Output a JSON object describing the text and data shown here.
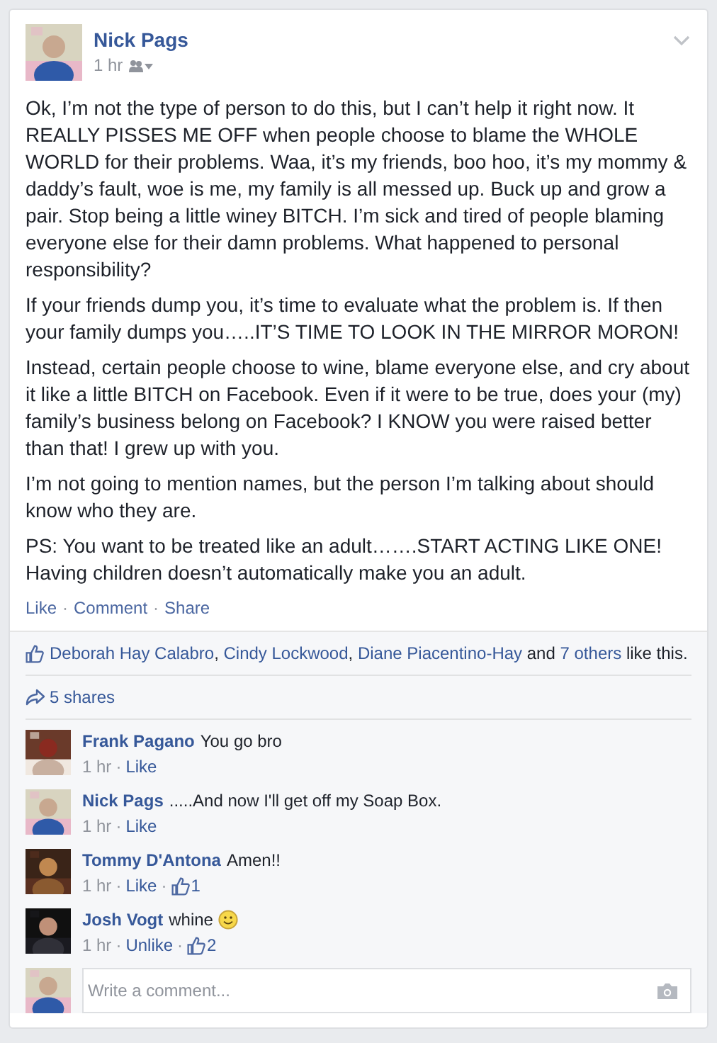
{
  "post": {
    "author": "Nick Pags",
    "time": "1 hr",
    "paragraphs": [
      "Ok, I’m not the type of person to do this, but I can’t help it right now. It REALLY PISSES ME OFF when people choose to blame the WHOLE WORLD for their problems. Waa, it’s my friends, boo hoo, it’s my mommy & daddy’s fault, woe is me, my family is all messed up. Buck up and grow a pair. Stop being a little winey BITCH. I’m sick and tired of people blaming everyone else for their damn problems. What happened to personal responsibility?",
      "If your friends dump you, it’s time to evaluate what the problem is. If then your family dumps you…..IT’S TIME TO LOOK IN THE MIRROR MORON!",
      "Instead, certain people choose to wine, blame everyone else, and cry about it like a little BITCH on Facebook. Even if it were to be true, does your (my) family’s business belong on Facebook? I KNOW you were raised better than that! I grew up with you.",
      "I’m not going to mention names, but the person I’m talking about should know who they are.",
      "PS: You want to be treated like an adult…….START ACTING LIKE ONE! Having children doesn’t automatically make you an adult."
    ],
    "actions": [
      "Like",
      "Comment",
      "Share"
    ]
  },
  "likes": {
    "names": [
      "Deborah Hay Calabro",
      "Cindy Lockwood",
      "Diane Piacentino-Hay"
    ],
    "and": "and",
    "others": "7 others",
    "suffix": "like this."
  },
  "shares": "5 shares",
  "comments": [
    {
      "author": "Frank Pagano",
      "text": "You go bro",
      "time": "1 hr",
      "action": "Like",
      "smiley": false
    },
    {
      "author": "Nick Pags",
      "text": ".....And now I'll get off my Soap Box.",
      "time": "1 hr",
      "action": "Like",
      "smiley": false
    },
    {
      "author": "Tommy D'Antona",
      "text": "Amen!!",
      "time": "1 hr",
      "action": "Like",
      "like_count": "1",
      "smiley": false
    },
    {
      "author": "Josh Vogt",
      "text": "whine",
      "time": "1 hr",
      "action": "Unlike",
      "like_count": "2",
      "smiley": true
    }
  ],
  "comment_box": {
    "placeholder": "Write a comment..."
  },
  "separator": "·",
  "comma": ","
}
